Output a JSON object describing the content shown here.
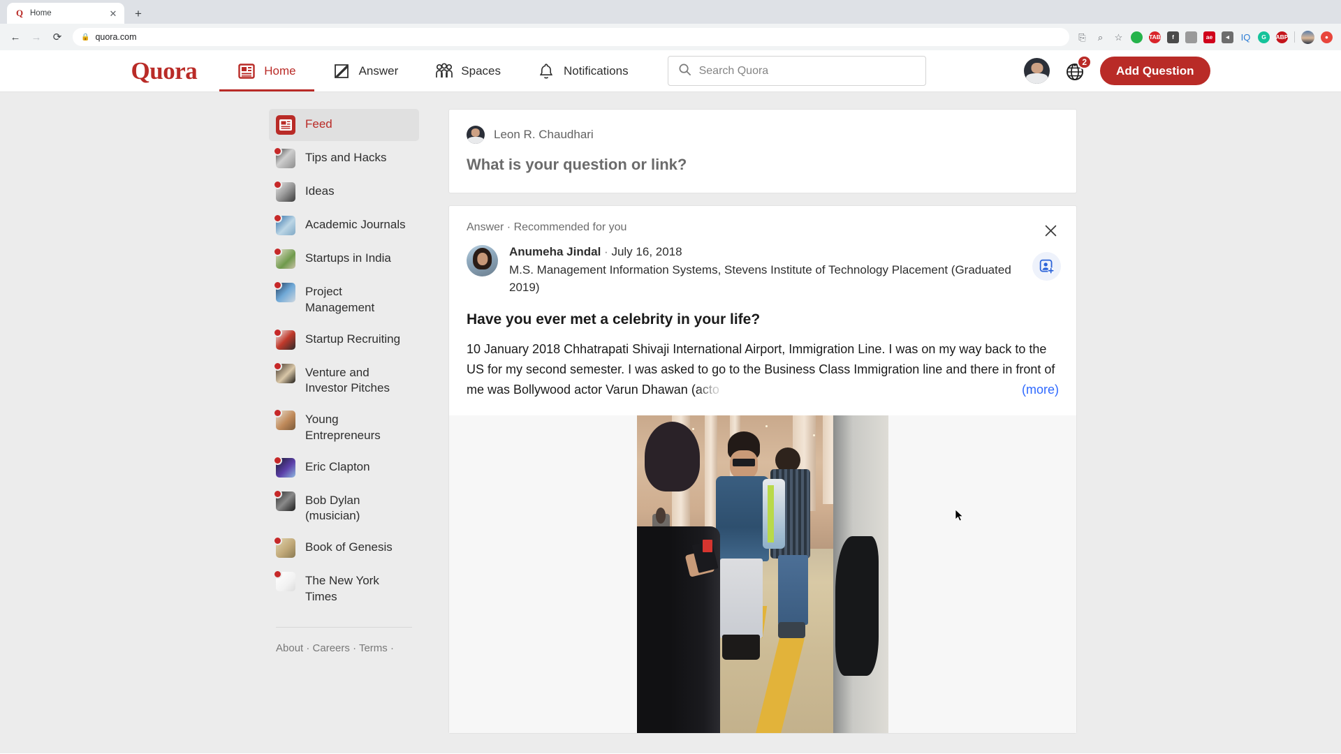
{
  "browser": {
    "tab": {
      "title": "Home",
      "favicon": "Q",
      "close_icon": "close-icon"
    },
    "new_tab_label": "+",
    "nav": {
      "back": "←",
      "forward": "→",
      "reload": "⟳"
    },
    "omnibox": {
      "url": "quora.com",
      "lock": "lock-icon"
    },
    "toolbar_icons": [
      {
        "name": "translate-icon",
        "glyph": "⎘",
        "color": "#5f6368",
        "bg": "none",
        "shape": "plain"
      },
      {
        "name": "zoom-search-icon",
        "glyph": "⌕",
        "color": "#5f6368",
        "bg": "none",
        "shape": "plain"
      },
      {
        "name": "bookmark-star-icon",
        "glyph": "☆",
        "color": "#5f6368",
        "bg": "none",
        "shape": "plain"
      },
      {
        "name": "extension-green-icon",
        "glyph": "",
        "color": "#ffffff",
        "bg": "#25b34b",
        "shape": "circle"
      },
      {
        "name": "extension-tab-icon",
        "glyph": "TAB",
        "color": "#ffffff",
        "bg": "#d9242a",
        "shape": "circle"
      },
      {
        "name": "facebook-icon",
        "glyph": "f",
        "color": "#ffffff",
        "bg": "#4b4b4b",
        "shape": "square"
      },
      {
        "name": "extension-gray-icon",
        "glyph": "",
        "color": "#ffffff",
        "bg": "#9a9a9a",
        "shape": "square"
      },
      {
        "name": "adblock-ae-icon",
        "glyph": "ae",
        "color": "#ffffff",
        "bg": "#d0021b",
        "shape": "square"
      },
      {
        "name": "pocket-icon",
        "glyph": "◄",
        "color": "#ffffff",
        "bg": "#6d6d6d",
        "shape": "square"
      },
      {
        "name": "iq-icon",
        "glyph": "IQ",
        "color": "#2a7bd4",
        "bg": "none",
        "shape": "plain"
      },
      {
        "name": "grammarly-icon",
        "glyph": "G",
        "color": "#ffffff",
        "bg": "#15c39a",
        "shape": "circle"
      },
      {
        "name": "adblock-plus-icon",
        "glyph": "ABP",
        "color": "#ffffff",
        "bg": "#c4151c",
        "shape": "circle"
      },
      {
        "name": "profile-avatar-icon",
        "glyph": "",
        "color": "#ffffff",
        "bg": "#4a6fa5",
        "shape": "avatar"
      },
      {
        "name": "extension-red-icon",
        "glyph": "●",
        "color": "#ffffff",
        "bg": "#e8463c",
        "shape": "circle"
      }
    ]
  },
  "header": {
    "logo": "Quora",
    "nav": [
      {
        "label": "Home",
        "icon": "home-feed-icon",
        "active": true
      },
      {
        "label": "Answer",
        "icon": "pencil-answer-icon",
        "active": false
      },
      {
        "label": "Spaces",
        "icon": "people-spaces-icon",
        "active": false
      },
      {
        "label": "Notifications",
        "icon": "bell-icon",
        "active": false
      }
    ],
    "search": {
      "placeholder": "Search Quora",
      "icon": "search-icon"
    },
    "avatar": "user-avatar",
    "globe": {
      "icon": "globe-icon",
      "badge": "2"
    },
    "add_question": "Add Question",
    "accent_color": "#b92b27"
  },
  "sidebar": {
    "items": [
      {
        "label": "Feed",
        "icon": "feed-icon",
        "active": true,
        "dot": false
      },
      {
        "label": "Tips and Hacks",
        "icon": "space-thumb",
        "active": false,
        "dot": true
      },
      {
        "label": "Ideas",
        "icon": "space-thumb",
        "active": false,
        "dot": true
      },
      {
        "label": "Academic Journals",
        "icon": "space-thumb",
        "active": false,
        "dot": true
      },
      {
        "label": "Startups in India",
        "icon": "space-thumb",
        "active": false,
        "dot": true
      },
      {
        "label": "Project Management",
        "icon": "space-thumb",
        "active": false,
        "dot": true
      },
      {
        "label": "Startup Recruiting",
        "icon": "space-thumb",
        "active": false,
        "dot": true
      },
      {
        "label": "Venture and Investor Pitches",
        "icon": "space-thumb",
        "active": false,
        "dot": true
      },
      {
        "label": "Young Entrepreneurs",
        "icon": "space-thumb",
        "active": false,
        "dot": true
      },
      {
        "label": "Eric Clapton",
        "icon": "space-thumb",
        "active": false,
        "dot": true
      },
      {
        "label": "Bob Dylan (musician)",
        "icon": "space-thumb",
        "active": false,
        "dot": true
      },
      {
        "label": "Book of Genesis",
        "icon": "space-thumb",
        "active": false,
        "dot": true
      },
      {
        "label": "The New York Times",
        "icon": "space-thumb",
        "active": false,
        "dot": true
      }
    ],
    "footer": [
      "About",
      "Careers",
      "Terms"
    ],
    "footer_separator": " · ",
    "footer_trailing": " ·"
  },
  "ask_card": {
    "user_name": "Leon R. Chaudhari",
    "avatar": "user-avatar",
    "placeholder": "What is your question or link?"
  },
  "answer_card": {
    "kicker": "Answer · Recommended for you",
    "close_icon": "close-icon",
    "follow_icon": "add-person-icon",
    "author": {
      "name": "Anumeha Jindal",
      "separator": "·",
      "date": "July 16, 2018",
      "credential": "M.S. Management Information Systems, Stevens Institute of Technology Placement (Graduated 2019)",
      "avatar": "author-avatar"
    },
    "question": "Have you ever met a celebrity in your life?",
    "body_visible": "10 January 2018 Chhatrapati Shivaji International Airport, Immigration Line. I was on my way back to the US for my second semester. I was asked to go to the Business Class Immigration line and there in front of me was Bollywood actor Varun Dhawan (acto",
    "body_fade_tail": "(acto",
    "more_label": "(more)",
    "image_alt": "airport-immigration-line-photo"
  }
}
